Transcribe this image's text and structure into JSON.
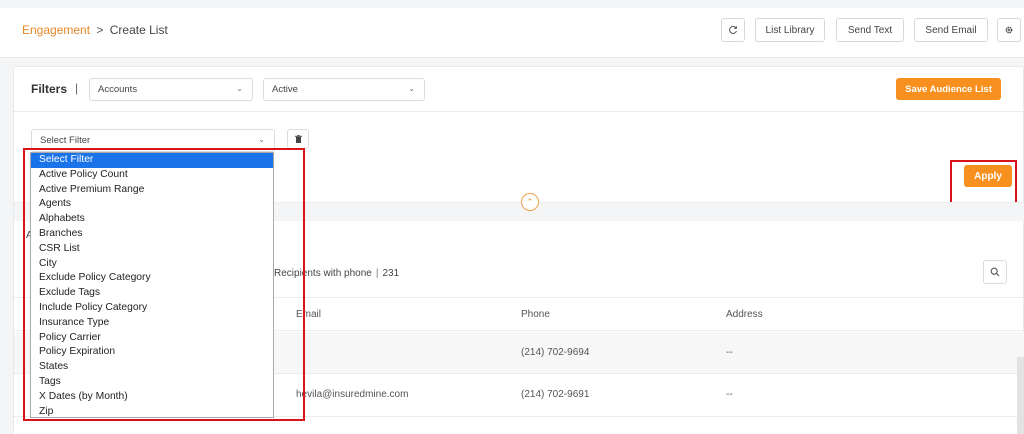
{
  "breadcrumb": {
    "parent": "Engagement",
    "separator": ">",
    "current": "Create List"
  },
  "toolbar": {
    "refresh_icon": "refresh-icon",
    "list_library": "List Library",
    "send_text": "Send Text",
    "send_email": "Send Email",
    "settings_icon": "gear-icon"
  },
  "filters": {
    "label": "Filters",
    "divider": "|",
    "entity_select": {
      "value": "Accounts"
    },
    "status_select": {
      "value": "Active"
    },
    "save_button": "Save Audience List",
    "filter_select": {
      "value": "Select Filter"
    },
    "apply_button": "Apply"
  },
  "dropdown": {
    "options": [
      "Select Filter",
      "Active Policy Count",
      "Active Premium Range",
      "Agents",
      "Alphabets",
      "Branches",
      "CSR List",
      "City",
      "Exclude Policy Category",
      "Exclude Tags",
      "Include Policy Category",
      "Insurance Type",
      "Policy Carrier",
      "Policy Expiration",
      "States",
      "Tags",
      "X Dates (by Month)",
      "Zip"
    ],
    "selected": "Select Filter"
  },
  "summary": {
    "partial_letter": "A",
    "recipients_label": "Recipients with phone",
    "divider": "|",
    "recipients_count": "231"
  },
  "table": {
    "columns": {
      "email": "Email",
      "phone": "Phone",
      "address": "Address"
    },
    "rows": [
      {
        "email": "",
        "phone": "(214) 702-9694",
        "address": "--"
      },
      {
        "email": "hevila@insuredmine.com",
        "phone": "(214) 702-9691",
        "address": "--"
      }
    ]
  },
  "colors": {
    "accent": "#f7901e",
    "highlight": "#d9121b",
    "selected": "#1a73e8"
  }
}
